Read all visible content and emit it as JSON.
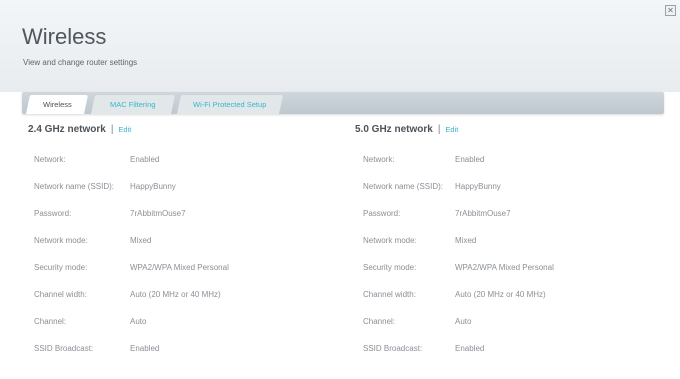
{
  "header": {
    "title": "Wireless",
    "subtitle": "View and change router settings",
    "close_glyph": "✕"
  },
  "tabs": [
    {
      "label": "Wireless",
      "active": true
    },
    {
      "label": "MAC Filtering",
      "active": false
    },
    {
      "label": "Wi-Fi Protected Setup",
      "active": false
    }
  ],
  "colors": {
    "accent": "#37b7c8",
    "text": "#4d5358",
    "muted": "#8a9096"
  },
  "networks": [
    {
      "title": "2.4 GHz network",
      "separator": "|",
      "edit_label": "Edit",
      "rows": [
        {
          "label": "Network:",
          "value": "Enabled"
        },
        {
          "label": "Network name (SSID):",
          "value": "HappyBunny"
        },
        {
          "label": "Password:",
          "value": "7rAbbitmOuse7"
        },
        {
          "label": "Network mode:",
          "value": "Mixed"
        },
        {
          "label": "Security mode:",
          "value": "WPA2/WPA Mixed Personal"
        },
        {
          "label": "Channel width:",
          "value": "Auto (20 MHz or 40 MHz)"
        },
        {
          "label": "Channel:",
          "value": "Auto"
        },
        {
          "label": "SSID Broadcast:",
          "value": "Enabled"
        }
      ]
    },
    {
      "title": "5.0 GHz network",
      "separator": "|",
      "edit_label": "Edit",
      "rows": [
        {
          "label": "Network:",
          "value": "Enabled"
        },
        {
          "label": "Network name (SSID):",
          "value": "HappyBunny"
        },
        {
          "label": "Password:",
          "value": "7rAbbitmOuse7"
        },
        {
          "label": "Network mode:",
          "value": "Mixed"
        },
        {
          "label": "Security mode:",
          "value": "WPA2/WPA Mixed Personal"
        },
        {
          "label": "Channel width:",
          "value": "Auto (20 MHz or 40 MHz)"
        },
        {
          "label": "Channel:",
          "value": "Auto"
        },
        {
          "label": "SSID Broadcast:",
          "value": "Enabled"
        }
      ]
    }
  ]
}
